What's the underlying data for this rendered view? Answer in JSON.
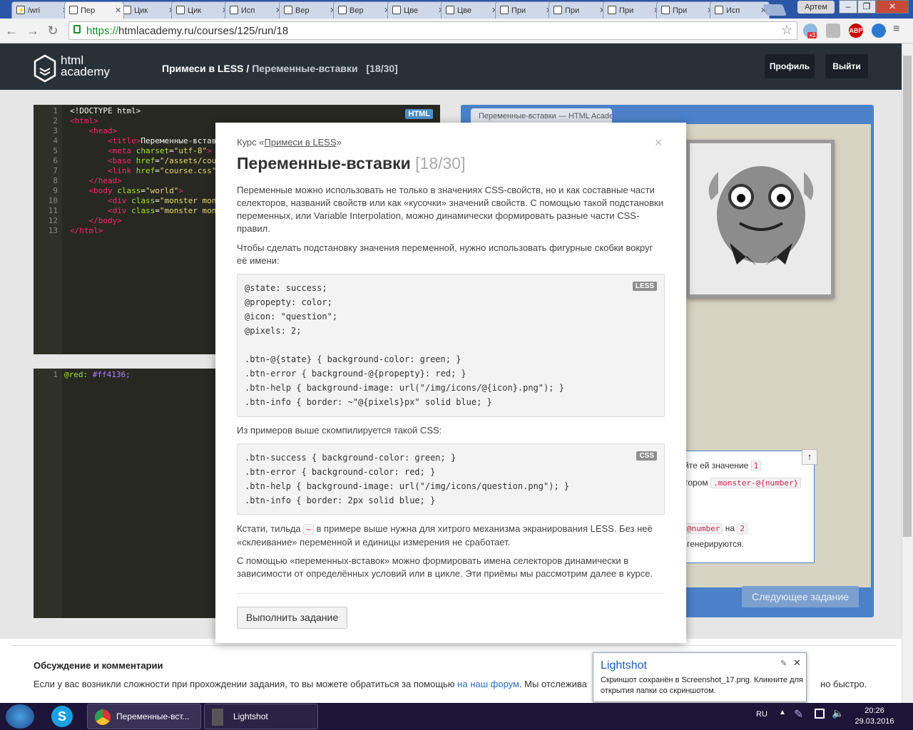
{
  "browser": {
    "tabs": [
      "/wri",
      "Пер",
      "Цик",
      "Цик",
      "Исп",
      "Вер",
      "Вер",
      "Цве",
      "Цве",
      "При",
      "При",
      "При",
      "При",
      "Исп"
    ],
    "user": "Артем",
    "url_scheme": "https://",
    "url_rest": "htmlacademy.ru/courses/125/run/18",
    "ext_badge": "+3",
    "abp": "ABP"
  },
  "header": {
    "logo_line1": "html",
    "logo_line2": "academy",
    "course": "Примеси в LESS",
    "sep": "/",
    "lesson": "Переменные-вставки",
    "progress": "[18/30]",
    "profile_btn": "Профиль",
    "logout_btn": "Выйти"
  },
  "editor_html": {
    "badge": "HTML",
    "line_numbers": [
      "1",
      "2",
      "3",
      "4",
      "5",
      "6",
      "7",
      "8",
      "9",
      "10",
      "11",
      "12",
      "13"
    ]
  },
  "editor_less": {
    "line_number": "1",
    "var": "@red:",
    "value": "#ff4136;"
  },
  "preview": {
    "tab_title": "Переменные-вставки — HTML Academy",
    "task_line1": "йте ей значение",
    "task_val1": "1",
    "task_line2": "тором",
    "task_code2": ".monster-@{number}",
    "task_code3": "@number",
    "task_line3": "на",
    "task_val3": "2",
    "task_line4": "генерируются.",
    "next_btn": "Следующее задание"
  },
  "modal": {
    "course_label": "Курс «",
    "course_link": "Примеси в LESS",
    "course_label_end": "»",
    "close": "×",
    "title": "Переменные-вставки",
    "title_num": "[18/30]",
    "p1": "Переменные можно использовать не только в значениях CSS-свойств, но и как составные части селекторов, названий свойств или как «кусочки» значений свойств. С помощью такой подстановки переменных, или Variable Interpolation, можно динамически формировать разные части CSS-правил.",
    "p2": "Чтобы сделать подстановку значения переменной, нужно использовать фигурные скобки вокруг её имени:",
    "less_badge": "LESS",
    "less_lines": [
      "@state: success;",
      "@propepty: color;",
      "@icon: \"question\";",
      "@pixels: 2;",
      "",
      ".btn-@{state} { background-color: green; }",
      ".btn-error { background-@{propepty}: red; }",
      ".btn-help { background-image: url(\"/img/icons/@{icon}.png\"); }",
      ".btn-info { border: ~\"@{pixels}px\" solid blue; }"
    ],
    "p3": "Из примеров выше скомпилируется такой CSS:",
    "css_badge": "CSS",
    "css_lines": [
      ".btn-success { background-color: green; }",
      ".btn-error { background-color: red; }",
      ".btn-help { background-image: url(\"/img/icons/question.png\"); }",
      ".btn-info { border: 2px solid blue; }"
    ],
    "p4a": "Кстати, тильда",
    "p4_tilde": "~",
    "p4b": "в примере выше нужна для хитрого механизма экранирования LESS. Без неё «склеивание» переменной и единицы измерения не сработает.",
    "p5": "С помощью «переменных-вставок» можно формировать имена селекторов динамически в зависимости от определённых условий или в цикле. Эти приёмы мы рассмотрим далее в курсе.",
    "run_btn": "Выполнить задание"
  },
  "discussion": {
    "title": "Обсуждение и комментарии",
    "text_a": "Если у вас возникли сложности при прохождении задания, то вы можете обратиться за помощью",
    "link": "на наш форум",
    "text_b": ". Мы отслежива",
    "text_end": "но быстро."
  },
  "toast": {
    "title": "Lightshot",
    "text": "Скриншот сохранён в Screenshot_17.png. Кликните для открытия папки со скриншотом."
  },
  "taskbar": {
    "chrome_item": "Переменные-вст...",
    "lightshot_item": "Lightshot",
    "lang": "RU",
    "time": "20:26",
    "date": "29.03.2016"
  }
}
